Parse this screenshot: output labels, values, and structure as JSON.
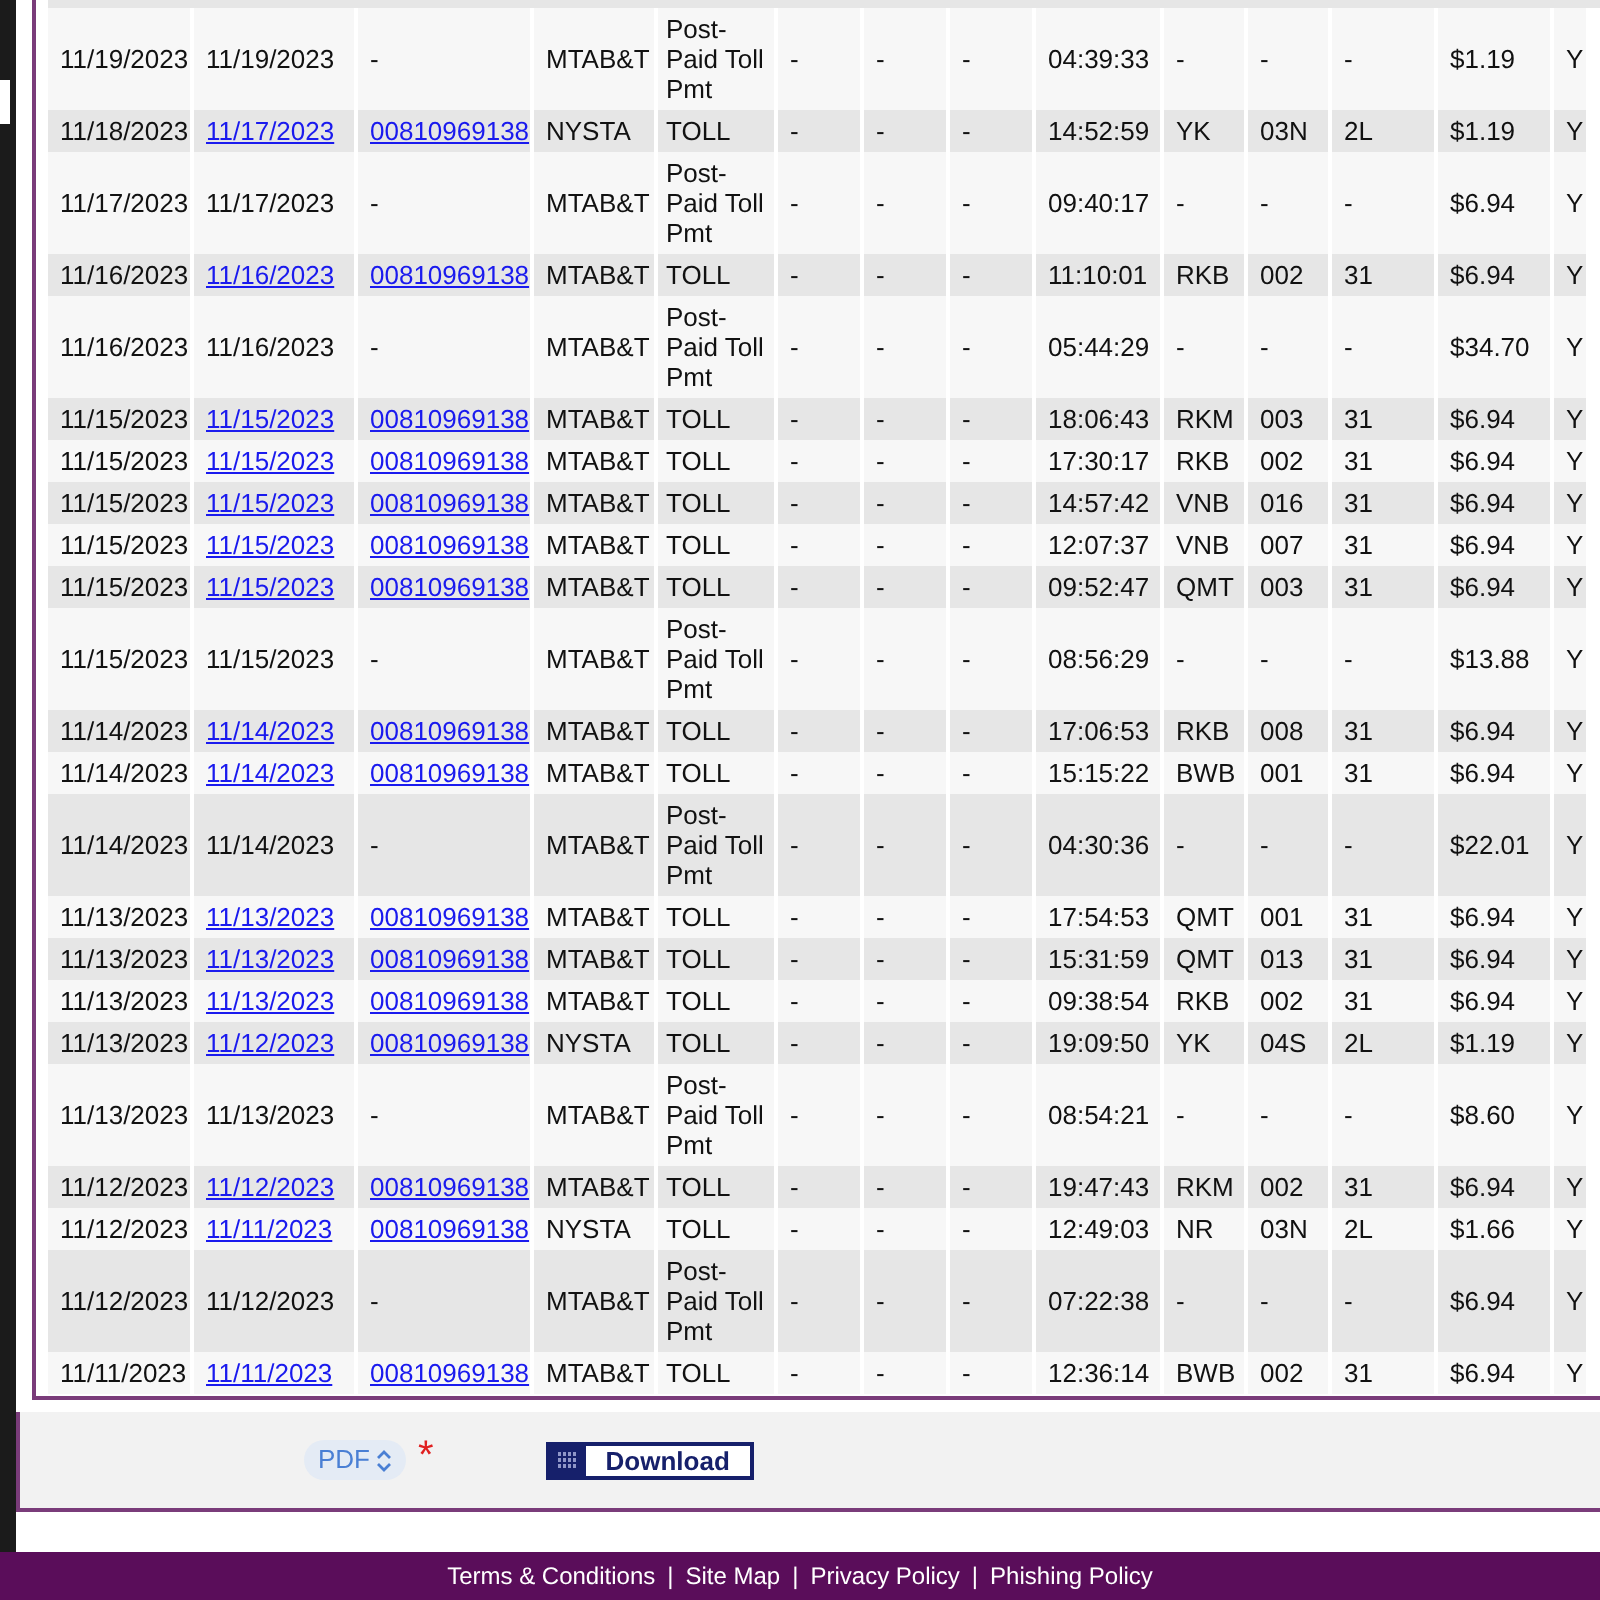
{
  "rows": [
    {
      "linked": false,
      "cells": [
        "11/19/2023",
        "11/19/2023",
        "-",
        "MTAB&T",
        "Post-Paid Toll Pmt",
        "-",
        "-",
        "-",
        "04:39:33",
        "-",
        "-",
        "-",
        "$1.19",
        "Y"
      ]
    },
    {
      "linked": true,
      "cells": [
        "11/18/2023",
        "11/17/2023",
        "00810969138",
        "NYSTA",
        "TOLL",
        "-",
        "-",
        "-",
        "14:52:59",
        "YK",
        "03N",
        "2L",
        "$1.19",
        "Y"
      ]
    },
    {
      "linked": false,
      "cells": [
        "11/17/2023",
        "11/17/2023",
        "-",
        "MTAB&T",
        "Post-Paid Toll Pmt",
        "-",
        "-",
        "-",
        "09:40:17",
        "-",
        "-",
        "-",
        "$6.94",
        "Y"
      ]
    },
    {
      "linked": true,
      "cells": [
        "11/16/2023",
        "11/16/2023",
        "00810969138",
        "MTAB&T",
        "TOLL",
        "-",
        "-",
        "-",
        "11:10:01",
        "RKB",
        "002",
        "31",
        "$6.94",
        "Y"
      ]
    },
    {
      "linked": false,
      "cells": [
        "11/16/2023",
        "11/16/2023",
        "-",
        "MTAB&T",
        "Post-Paid Toll Pmt",
        "-",
        "-",
        "-",
        "05:44:29",
        "-",
        "-",
        "-",
        "$34.70",
        "Y"
      ]
    },
    {
      "linked": true,
      "cells": [
        "11/15/2023",
        "11/15/2023",
        "00810969138",
        "MTAB&T",
        "TOLL",
        "-",
        "-",
        "-",
        "18:06:43",
        "RKM",
        "003",
        "31",
        "$6.94",
        "Y"
      ]
    },
    {
      "linked": true,
      "cells": [
        "11/15/2023",
        "11/15/2023",
        "00810969138",
        "MTAB&T",
        "TOLL",
        "-",
        "-",
        "-",
        "17:30:17",
        "RKB",
        "002",
        "31",
        "$6.94",
        "Y"
      ]
    },
    {
      "linked": true,
      "cells": [
        "11/15/2023",
        "11/15/2023",
        "00810969138",
        "MTAB&T",
        "TOLL",
        "-",
        "-",
        "-",
        "14:57:42",
        "VNB",
        "016",
        "31",
        "$6.94",
        "Y"
      ]
    },
    {
      "linked": true,
      "cells": [
        "11/15/2023",
        "11/15/2023",
        "00810969138",
        "MTAB&T",
        "TOLL",
        "-",
        "-",
        "-",
        "12:07:37",
        "VNB",
        "007",
        "31",
        "$6.94",
        "Y"
      ]
    },
    {
      "linked": true,
      "cells": [
        "11/15/2023",
        "11/15/2023",
        "00810969138",
        "MTAB&T",
        "TOLL",
        "-",
        "-",
        "-",
        "09:52:47",
        "QMT",
        "003",
        "31",
        "$6.94",
        "Y"
      ]
    },
    {
      "linked": false,
      "cells": [
        "11/15/2023",
        "11/15/2023",
        "-",
        "MTAB&T",
        "Post-Paid Toll Pmt",
        "-",
        "-",
        "-",
        "08:56:29",
        "-",
        "-",
        "-",
        "$13.88",
        "Y"
      ]
    },
    {
      "linked": true,
      "cells": [
        "11/14/2023",
        "11/14/2023",
        "00810969138",
        "MTAB&T",
        "TOLL",
        "-",
        "-",
        "-",
        "17:06:53",
        "RKB",
        "008",
        "31",
        "$6.94",
        "Y"
      ]
    },
    {
      "linked": true,
      "cells": [
        "11/14/2023",
        "11/14/2023",
        "00810969138",
        "MTAB&T",
        "TOLL",
        "-",
        "-",
        "-",
        "15:15:22",
        "BWB",
        "001",
        "31",
        "$6.94",
        "Y"
      ]
    },
    {
      "linked": false,
      "cells": [
        "11/14/2023",
        "11/14/2023",
        "-",
        "MTAB&T",
        "Post-Paid Toll Pmt",
        "-",
        "-",
        "-",
        "04:30:36",
        "-",
        "-",
        "-",
        "$22.01",
        "Y"
      ]
    },
    {
      "linked": true,
      "cells": [
        "11/13/2023",
        "11/13/2023",
        "00810969138",
        "MTAB&T",
        "TOLL",
        "-",
        "-",
        "-",
        "17:54:53",
        "QMT",
        "001",
        "31",
        "$6.94",
        "Y"
      ]
    },
    {
      "linked": true,
      "cells": [
        "11/13/2023",
        "11/13/2023",
        "00810969138",
        "MTAB&T",
        "TOLL",
        "-",
        "-",
        "-",
        "15:31:59",
        "QMT",
        "013",
        "31",
        "$6.94",
        "Y"
      ]
    },
    {
      "linked": true,
      "cells": [
        "11/13/2023",
        "11/13/2023",
        "00810969138",
        "MTAB&T",
        "TOLL",
        "-",
        "-",
        "-",
        "09:38:54",
        "RKB",
        "002",
        "31",
        "$6.94",
        "Y"
      ]
    },
    {
      "linked": true,
      "cells": [
        "11/13/2023",
        "11/12/2023",
        "00810969138",
        "NYSTA",
        "TOLL",
        "-",
        "-",
        "-",
        "19:09:50",
        "YK",
        "04S",
        "2L",
        "$1.19",
        "Y"
      ]
    },
    {
      "linked": false,
      "cells": [
        "11/13/2023",
        "11/13/2023",
        "-",
        "MTAB&T",
        "Post-Paid Toll Pmt",
        "-",
        "-",
        "-",
        "08:54:21",
        "-",
        "-",
        "-",
        "$8.60",
        "Y"
      ]
    },
    {
      "linked": true,
      "cells": [
        "11/12/2023",
        "11/12/2023",
        "00810969138",
        "MTAB&T",
        "TOLL",
        "-",
        "-",
        "-",
        "19:47:43",
        "RKM",
        "002",
        "31",
        "$6.94",
        "Y"
      ]
    },
    {
      "linked": true,
      "cells": [
        "11/12/2023",
        "11/11/2023",
        "00810969138",
        "NYSTA",
        "TOLL",
        "-",
        "-",
        "-",
        "12:49:03",
        "NR",
        "03N",
        "2L",
        "$1.66",
        "Y"
      ]
    },
    {
      "linked": false,
      "cells": [
        "11/12/2023",
        "11/12/2023",
        "-",
        "MTAB&T",
        "Post-Paid Toll Pmt",
        "-",
        "-",
        "-",
        "07:22:38",
        "-",
        "-",
        "-",
        "$6.94",
        "Y"
      ]
    },
    {
      "linked": true,
      "cells": [
        "11/11/2023",
        "11/11/2023",
        "00810969138",
        "MTAB&T",
        "TOLL",
        "-",
        "-",
        "-",
        "12:36:14",
        "BWB",
        "002",
        "31",
        "$6.94",
        "Y"
      ]
    }
  ],
  "format_select": {
    "value": "PDF",
    "required_mark": "*"
  },
  "download_button": {
    "label": "Download"
  },
  "footer": {
    "links": [
      "Terms & Conditions",
      "Site Map",
      "Privacy Policy",
      "Phishing Policy"
    ],
    "separators": [
      "|",
      "|",
      "|"
    ]
  }
}
